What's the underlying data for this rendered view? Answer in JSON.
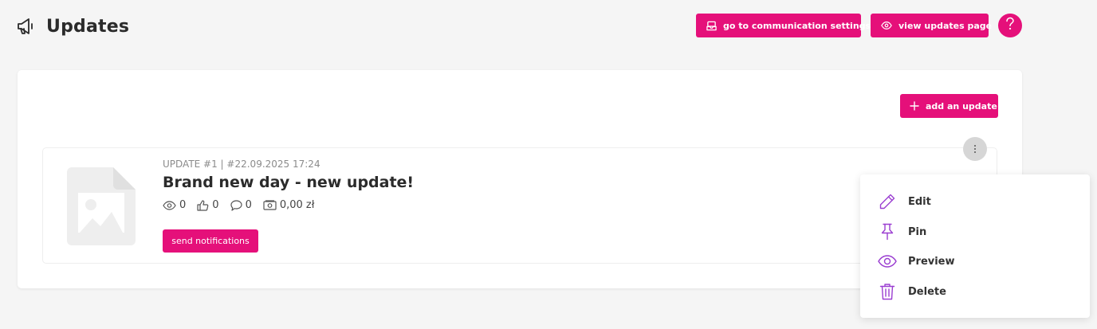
{
  "header": {
    "title": "Updates",
    "icon": "megaphone-icon",
    "comm_settings_label": "go to communication settings",
    "view_updates_label": "view updates page",
    "help_icon": "question-icon"
  },
  "card": {
    "add_update_label": "add an update"
  },
  "update": {
    "meta": "UPDATE #1 | #22.09.2025 17:24",
    "title": "Brand new day - new update!",
    "views": "0",
    "likes": "0",
    "comments": "0",
    "amount": "0,00 zł",
    "notify_label": "send notifications"
  },
  "menu": {
    "items": [
      {
        "label": "Edit",
        "icon": "pencil-icon"
      },
      {
        "label": "Pin",
        "icon": "pin-icon"
      },
      {
        "label": "Preview",
        "icon": "eye-icon"
      },
      {
        "label": "Delete",
        "icon": "trash-icon"
      }
    ]
  },
  "colors": {
    "accent": "#e5107a",
    "menu_icon": "#9b3fd1"
  }
}
